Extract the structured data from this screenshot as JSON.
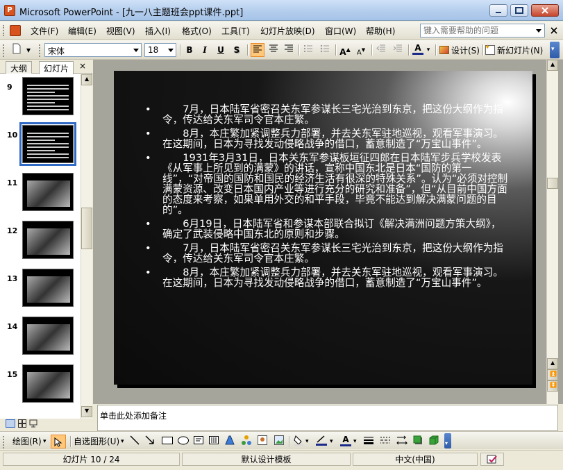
{
  "window": {
    "title": "Microsoft PowerPoint - [九一八主题班会ppt课件.ppt]",
    "app_icon_label": "P"
  },
  "menu": {
    "items": [
      "文件(F)",
      "编辑(E)",
      "视图(V)",
      "插入(I)",
      "格式(O)",
      "工具(T)",
      "幻灯片放映(D)",
      "窗口(W)",
      "帮助(H)"
    ],
    "help_placeholder": "键入需要帮助的问题"
  },
  "toolbar": {
    "font_name": "宋体",
    "font_size": "18",
    "bold": "B",
    "italic": "I",
    "underline": "U",
    "shadow": "S",
    "design_label": "设计(S)",
    "new_slide_label": "新幻灯片(N)"
  },
  "left_pane": {
    "tab_outline": "大纲",
    "tab_slides": "幻灯片",
    "close": "×",
    "thumbnails": [
      {
        "num": "9",
        "kind": "text"
      },
      {
        "num": "10",
        "kind": "text",
        "selected": true
      },
      {
        "num": "11",
        "kind": "photo"
      },
      {
        "num": "12",
        "kind": "photo"
      },
      {
        "num": "13",
        "kind": "photo"
      },
      {
        "num": "14",
        "kind": "photo"
      },
      {
        "num": "15",
        "kind": "photo"
      }
    ]
  },
  "slide": {
    "paragraphs": [
      "　　7月，日本陆军省密召关东军参谋长三宅光治到东京，把这份大纲作为指令，传达给关东军司令官本庄繁。",
      "　　8月，本庄繁加紧调整兵力部署，并去关东军驻地巡视，观看军事演习。在这期间，日本为寻找发动侵略战争的借口，蓄意制造了“万宝山事件”。",
      "　　1931年3月31日，日本关东军参谋板垣征四郎在日本陆军步兵学校发表《从军事上所见到的满蒙》的讲话，宣称中国东北是日本“国防的第一线”，“对帝国的国防和国民的经济生活有很深的特殊关系”。认为“必须对控制满蒙资源、改变日本国内产业等进行充分的研究和准备”，但“从目前中国方面的态度来考察，如果单用外交的和平手段，毕竟不能达到解决满蒙问题的目的”。",
      "　　6月19日，日本陆军省和参谋本部联合拟订《解决满洲问题方策大纲》，确定了武装侵略中国东北的原则和步骤。",
      "　　7月，日本陆军省密召关东军参谋长三宅光治到东京，把这份大纲作为指令，传达给关东军司令官本庄繁。",
      "　　8月，本庄繁加紧调整兵力部署，并去关东军驻地巡视，观看军事演习。在这期间，日本为寻找发动侵略战争的借口，蓄意制造了“万宝山事件”。"
    ],
    "bullet": "•"
  },
  "notes": {
    "placeholder": "单击此处添加备注"
  },
  "drawbar": {
    "draw_label": "绘图(R)",
    "autoshapes_label": "自选图形(U)"
  },
  "status": {
    "slide_info": "幻灯片 10 / 24",
    "template": "默认设计模板",
    "language": "中文(中国)"
  }
}
